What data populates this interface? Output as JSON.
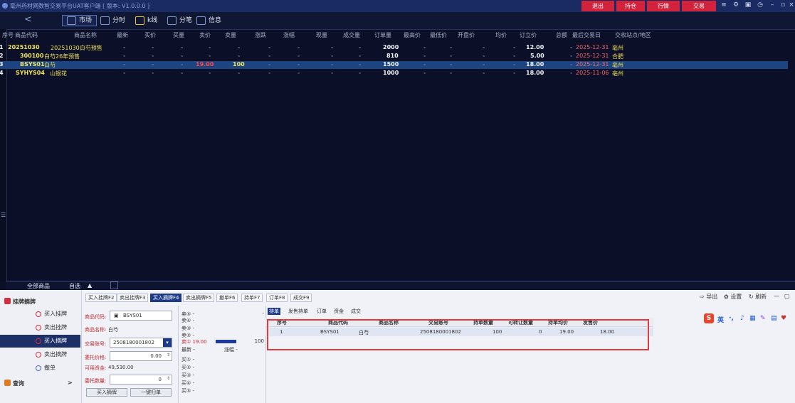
{
  "window": {
    "title": "毫州药材网数智交易平台UAT客户端 [ 版本: V1.0.0.0 ]",
    "buttons": [
      "退出",
      "持仓",
      "行情",
      "交易"
    ]
  },
  "toolbar": {
    "back": "<",
    "items": [
      "市场",
      "分时",
      "k线",
      "分笔",
      "信息"
    ]
  },
  "grid": {
    "headers": [
      "序号",
      "商品代码",
      "商品名称",
      "最新",
      "买价",
      "买量",
      "卖价",
      "卖量",
      "涨跌",
      "涨幅",
      "现量",
      "成交量",
      "订单量",
      "最高价",
      "最低价",
      "开盘价",
      "均价",
      "订立价",
      "总额",
      "最后交易日",
      "交收站点/地区"
    ],
    "rows": [
      {
        "no": "1",
        "code": "20251030",
        "name": "20251030白芍预售",
        "latest": "-",
        "bid": "-",
        "bidvol": "-",
        "ask": "-",
        "askvol": "-",
        "chg": "-",
        "pct": "-",
        "cur": "-",
        "vol": "-",
        "orders": "2000",
        "high": "-",
        "low": "-",
        "open": "-",
        "avg": "-",
        "price": "12.00",
        "total": "-",
        "lastday": "2025-12-31",
        "site": "亳州"
      },
      {
        "no": "2",
        "code": "300100",
        "name": "白芍26年预售",
        "latest": "-",
        "bid": "-",
        "bidvol": "-",
        "ask": "-",
        "askvol": "-",
        "chg": "-",
        "pct": "-",
        "cur": "-",
        "vol": "-",
        "orders": "810",
        "high": "-",
        "low": "-",
        "open": "-",
        "avg": "-",
        "price": "5.00",
        "total": "-",
        "lastday": "2025-12-31",
        "site": "合肥"
      },
      {
        "no": "3",
        "code": "BSYS01",
        "name": "白芍",
        "latest": "-",
        "bid": "-",
        "bidvol": "-",
        "ask": "19.00",
        "askvol": "100",
        "chg": "-",
        "pct": "-",
        "cur": "-",
        "vol": "-",
        "orders": "1500",
        "high": "-",
        "low": "-",
        "open": "-",
        "avg": "-",
        "price": "18.00",
        "total": "-",
        "lastday": "2025-12-31",
        "site": "亳州"
      },
      {
        "no": "4",
        "code": "SYHYS04",
        "name": "山银花",
        "latest": "-",
        "bid": "-",
        "bidvol": "-",
        "ask": "-",
        "askvol": "-",
        "chg": "-",
        "pct": "-",
        "cur": "-",
        "vol": "-",
        "orders": "1000",
        "high": "-",
        "low": "-",
        "open": "-",
        "avg": "-",
        "price": "18.00",
        "total": "-",
        "lastday": "2025-11-06",
        "site": "亳州"
      }
    ]
  },
  "tabs": {
    "all": "全部商品",
    "self": "自选",
    "arrow": "▲"
  },
  "nav": {
    "header": "挂牌摘牌",
    "items": [
      "买入挂牌",
      "卖出挂牌",
      "买入摘牌",
      "卖出摘牌",
      "撤单"
    ],
    "query": "查询",
    "query_arrow": ">"
  },
  "bottom_tabs": [
    "买入挂牌F2",
    "卖出挂牌F3",
    "买入摘牌F4",
    "卖出摘牌F5",
    "撤单F6",
    "持单F7",
    "订单F8",
    "成交F9"
  ],
  "form": {
    "code_label": "商品代码:",
    "code_value": "BSYS01",
    "name_label": "商品名称:",
    "name_value": "白芍",
    "account_label": "交易账号:",
    "account_value": "2508180001802",
    "price_label": "委托价格:",
    "price_value": "0.00",
    "funds_label": "可用资金:",
    "funds_value": "49,530.00",
    "qty_label": "委托数量:",
    "qty_value": "0",
    "buy_btn": "买入摘牌",
    "clear_btn": "一键归单"
  },
  "quote": {
    "sell_rows": [
      "卖⑤ -",
      "卖④ -",
      "卖③ -",
      "卖② -",
      "卖① 19.00"
    ],
    "sell_vol": "100",
    "latest": "最新 -",
    "change": "涨幅 -",
    "buy_rows": [
      "买① -",
      "买② -",
      "买③ -",
      "买④ -",
      "买⑤ -"
    ]
  },
  "orders": {
    "tabs": [
      "持单",
      "发售持单",
      "订单",
      "资金",
      "成交"
    ],
    "headers": [
      "序号",
      "商品代码",
      "商品名称",
      "交易账号",
      "持单数量",
      "可转让数量",
      "持单均价",
      "发售价"
    ],
    "rows": [
      [
        "1",
        "BSYS01",
        "白芍",
        "2508180001802",
        "100",
        "0",
        "19.00",
        "18.00"
      ]
    ]
  },
  "right_tools": [
    "导出",
    "设置",
    "刷新"
  ],
  "ime": "英"
}
